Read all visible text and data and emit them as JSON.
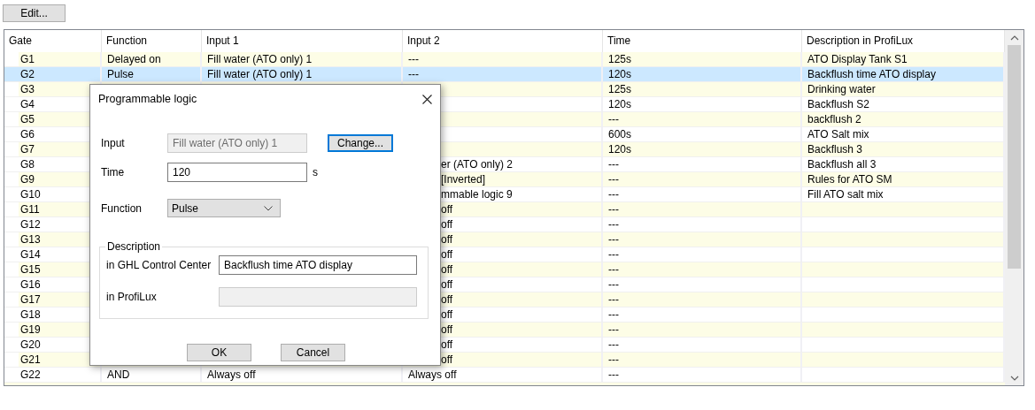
{
  "toolbar": {
    "buttons": [
      {
        "label": "Edit..."
      }
    ]
  },
  "table": {
    "columns": [
      "Gate",
      "Function",
      "Input 1",
      "Input 2",
      "Time",
      "Description in ProfiLux"
    ],
    "rows": [
      {
        "selected": false,
        "cells": [
          "G1",
          "Delayed on",
          "Fill water (ATO only) 1",
          "---",
          "125s",
          "ATO Display Tank S1"
        ]
      },
      {
        "selected": true,
        "cells": [
          "G2",
          "Pulse",
          "Fill water (ATO only) 1",
          "---",
          "120s",
          "Backflush time ATO display"
        ]
      },
      {
        "selected": false,
        "cells": [
          "G3",
          null,
          null,
          null,
          "125s",
          "Drinking water"
        ]
      },
      {
        "selected": false,
        "cells": [
          "G4",
          null,
          null,
          null,
          "120s",
          "Backflush S2"
        ]
      },
      {
        "selected": false,
        "cells": [
          "G5",
          null,
          null,
          null,
          "---",
          "backflush 2"
        ]
      },
      {
        "selected": false,
        "cells": [
          "G6",
          null,
          null,
          null,
          "600s",
          "ATO Salt mix"
        ]
      },
      {
        "selected": false,
        "cells": [
          "G7",
          null,
          null,
          null,
          "120s",
          "Backflush 3"
        ]
      },
      {
        "selected": false,
        "cells": [
          "G8",
          null,
          null,
          "er (ATO only) 2",
          "---",
          "Backflush all 3"
        ]
      },
      {
        "selected": false,
        "cells": [
          "G9",
          null,
          null,
          "[Inverted]",
          "---",
          "Rules for ATO SM"
        ]
      },
      {
        "selected": false,
        "cells": [
          "G10",
          null,
          null,
          "mmable logic 9",
          "---",
          "Fill ATO salt mix"
        ]
      },
      {
        "selected": false,
        "cells": [
          "G11",
          null,
          null,
          "off",
          "---",
          null
        ]
      },
      {
        "selected": false,
        "cells": [
          "G12",
          null,
          null,
          "off",
          "---",
          null
        ]
      },
      {
        "selected": false,
        "cells": [
          "G13",
          null,
          null,
          "off",
          "---",
          null
        ]
      },
      {
        "selected": false,
        "cells": [
          "G14",
          null,
          null,
          "off",
          "---",
          null
        ]
      },
      {
        "selected": false,
        "cells": [
          "G15",
          null,
          null,
          "off",
          "---",
          null
        ]
      },
      {
        "selected": false,
        "cells": [
          "G16",
          null,
          null,
          "off",
          "---",
          null
        ]
      },
      {
        "selected": false,
        "cells": [
          "G17",
          null,
          null,
          "off",
          "---",
          null
        ]
      },
      {
        "selected": false,
        "cells": [
          "G18",
          null,
          null,
          "off",
          "---",
          null
        ]
      },
      {
        "selected": false,
        "cells": [
          "G19",
          null,
          null,
          "off",
          "---",
          null
        ]
      },
      {
        "selected": false,
        "cells": [
          "G20",
          null,
          null,
          "off",
          "---",
          null
        ]
      },
      {
        "selected": false,
        "cells": [
          "G21",
          null,
          null,
          "off",
          "---",
          null
        ]
      },
      {
        "selected": false,
        "cells": [
          "G22",
          "AND",
          "Always off",
          "Always off",
          "---",
          null
        ]
      }
    ]
  },
  "dialog": {
    "title": "Programmable logic",
    "input": {
      "label": "Input",
      "value": "Fill water (ATO only) 1",
      "disabled": true
    },
    "change_button": {
      "label": "Change...",
      "focused": true
    },
    "time": {
      "label": "Time",
      "value": "120",
      "unit": "s"
    },
    "function": {
      "label": "Function",
      "value": "Pulse"
    },
    "description": {
      "title": "Description",
      "fields": [
        {
          "label": "in GHL Control Center",
          "value": "Backflush time ATO display",
          "disabled": false
        },
        {
          "label": "in ProfiLux",
          "disabled": true
        }
      ]
    },
    "buttons": [
      {
        "label": "OK"
      },
      {
        "label": "Cancel"
      }
    ]
  }
}
